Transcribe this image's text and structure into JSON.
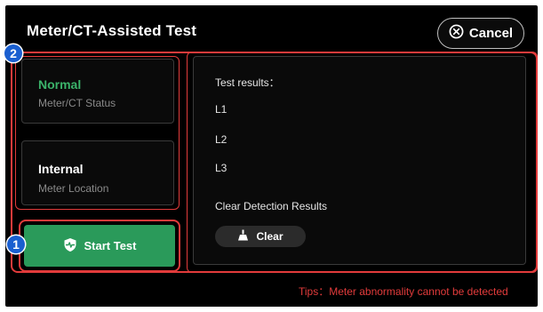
{
  "header": {
    "title": "Meter/CT-Assisted Test",
    "cancel_label": "Cancel"
  },
  "status_card": {
    "value": "Normal",
    "label": "Meter/CT Status"
  },
  "location_card": {
    "value": "Internal",
    "label": "Meter Location"
  },
  "start_button": {
    "label": "Start Test"
  },
  "results": {
    "heading": "Test results：",
    "lines": [
      "L1",
      "L2",
      "L3"
    ],
    "clear_heading": "Clear Detection Results",
    "clear_label": "Clear"
  },
  "annotations": {
    "badge_1": "1",
    "badge_2": "2",
    "tips": "Tips：Meter abnormality cannot be detected"
  },
  "colors": {
    "background": "#000000",
    "accent_green": "#2a9a5a",
    "status_green": "#3bb36a",
    "annotation_red": "#e23b3b",
    "badge_blue": "#1a5fd0"
  },
  "icons": {
    "cancel": "close-circle-icon",
    "start": "shield-heartbeat-icon",
    "clear": "broom-icon"
  }
}
